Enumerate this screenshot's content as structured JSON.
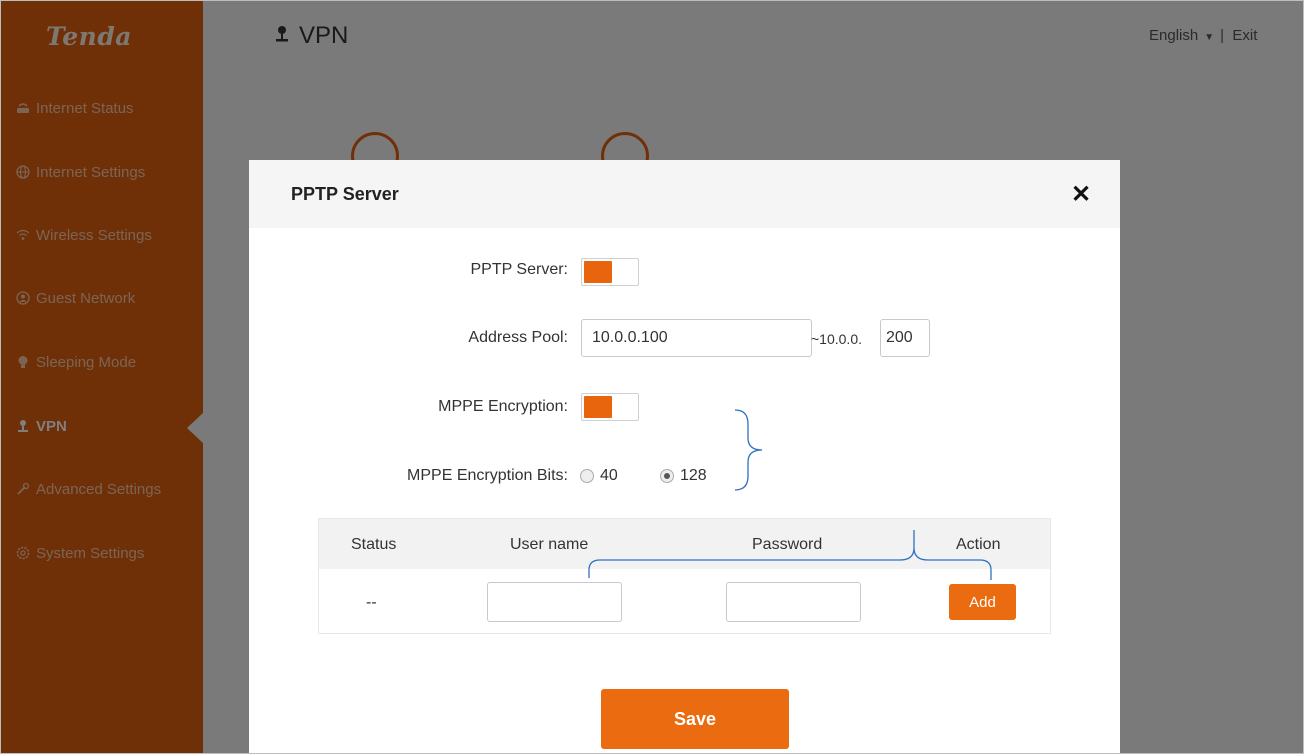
{
  "sidebar": {
    "logo": "Tenda",
    "items": [
      {
        "label": "Internet Status",
        "icon": "router-icon"
      },
      {
        "label": "Internet Settings",
        "icon": "globe-icon"
      },
      {
        "label": "Wireless Settings",
        "icon": "wifi-icon"
      },
      {
        "label": "Guest Network",
        "icon": "guest-icon"
      },
      {
        "label": "Sleeping Mode",
        "icon": "bulb-icon"
      },
      {
        "label": "VPN",
        "icon": "vpn-icon",
        "active": true
      },
      {
        "label": "Advanced Settings",
        "icon": "wrench-icon"
      },
      {
        "label": "System Settings",
        "icon": "gear-icon"
      }
    ]
  },
  "header": {
    "title": "VPN",
    "language": "English",
    "separator": "|",
    "exit_label": "Exit"
  },
  "dialog": {
    "title": "PPTP Server",
    "close_label": "✕",
    "pptp_server_label": "PPTP Server:",
    "pptp_server_enabled": true,
    "address_pool_label": "Address Pool:",
    "address_pool_start": "10.0.0.100",
    "address_pool_sep": "~10.0.0.",
    "address_pool_end": "200",
    "mppe_label": "MPPE Encryption:",
    "mppe_enabled": true,
    "mppe_bits_label": "MPPE Encryption Bits:",
    "mppe_bits_options": [
      "40",
      "128"
    ],
    "mppe_bits_selected": "128",
    "table": {
      "headers": [
        "Status",
        "User name",
        "Password",
        "Action"
      ],
      "row": {
        "status": "--",
        "username": "",
        "password": ""
      },
      "add_label": "Add"
    },
    "save_label": "Save"
  },
  "colors": {
    "accent": "#ea6b10",
    "sidebar_bg": "#e0610f",
    "annotation_line": "#2f6fc4"
  }
}
